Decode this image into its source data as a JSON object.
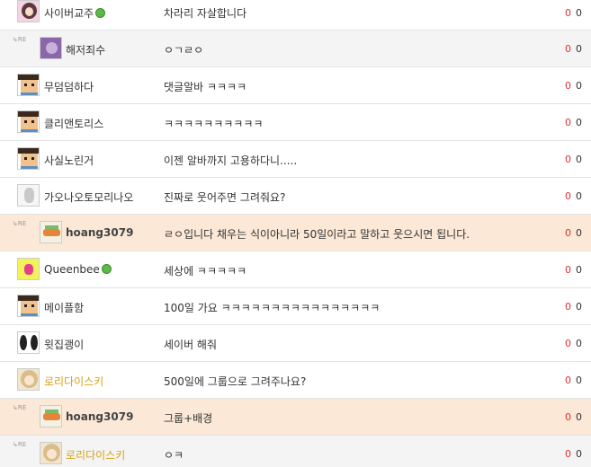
{
  "rows": [
    {
      "nick": "사이버교주",
      "content": "차라리 자살합니다",
      "recommend": "0",
      "views": "0"
    },
    {
      "re": "RE",
      "nick": "해저죄수",
      "content": "ㅇㄱㄹㅇ",
      "recommend": "0",
      "views": "0"
    },
    {
      "nick": "무덤덤하다",
      "content": "댓글알바 ㅋㅋㅋㅋ",
      "recommend": "0",
      "views": "0"
    },
    {
      "nick": "클리앤토리스",
      "content": "ㅋㅋㅋㅋㅋㅋㅋㅋㅋㅋ",
      "recommend": "0",
      "views": "0"
    },
    {
      "nick": "사실노린거",
      "content": "이젠 알바까지 고용하다니.....",
      "recommend": "0",
      "views": "0"
    },
    {
      "nick": "가오나오토모리나오",
      "content": "진짜로 웃어주면 그려줘요?",
      "recommend": "0",
      "views": "0"
    },
    {
      "re": "RE",
      "nick": "hoang3079",
      "content": "ㄹㅇ입니다 채우는 식이아니라 50일이라고 말하고 웃으시면 됩니다.",
      "recommend": "0",
      "views": "0"
    },
    {
      "nick": "Queenbee",
      "content": "세상에 ㅋㅋㅋㅋㅋ",
      "recommend": "0",
      "views": "0"
    },
    {
      "nick": "메이플함",
      "content": "100일 가요 ㅋㅋㅋㅋㅋㅋㅋㅋㅋㅋㅋㅋㅋㅋㅋㅋ",
      "recommend": "0",
      "views": "0"
    },
    {
      "nick": "윗집괭이",
      "content": "세이버 해줘",
      "recommend": "0",
      "views": "0"
    },
    {
      "nick": "로리다이스키",
      "content": "500일에 그룹으로 그려주나요?",
      "recommend": "0",
      "views": "0"
    },
    {
      "re": "RE",
      "nick": "hoang3079",
      "content": "그룹+배경",
      "recommend": "0",
      "views": "0"
    },
    {
      "re": "RE",
      "nick": "로리다이스키",
      "content": "ㅇㅋ",
      "recommend": "0",
      "views": "0"
    }
  ],
  "colors": {
    "recommend": "#e03030",
    "highlight_row": "#fbe8d6",
    "reply_row": "#f4f4f4",
    "gold_nick": "#d6a21a",
    "online": "#5fb84a"
  },
  "icons": {
    "online": "online-status-icon",
    "reply": "reply-arrow-icon"
  }
}
